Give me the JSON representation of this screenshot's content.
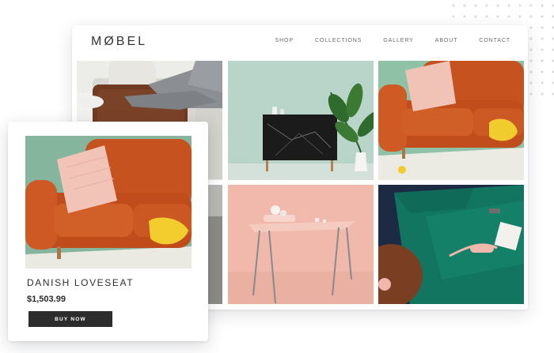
{
  "brand": {
    "logo": "MØBEL"
  },
  "nav": {
    "items": [
      "SHOP",
      "COLLECTIONS",
      "GALLERY",
      "ABOUT",
      "CONTACT"
    ]
  },
  "gallery": {
    "tiles": [
      {
        "subject": "person-lounging-on-sofa"
      },
      {
        "subject": "marble-sideboard-with-plant"
      },
      {
        "subject": "orange-sofa-with-pillow"
      },
      {
        "subject": "armchair-detail"
      },
      {
        "subject": "pink-table-with-vases"
      },
      {
        "subject": "green-sofa-with-phone"
      }
    ]
  },
  "product": {
    "name": "DANISH LOVESEAT",
    "price": "$1,503.99",
    "buy_label": "BUY NOW"
  },
  "colors": {
    "text": "#2e2e2e",
    "button": "#2d2d2d",
    "sofa_orange": "#c5521f",
    "sofa_green": "#137a62",
    "pink": "#efb8aa"
  }
}
